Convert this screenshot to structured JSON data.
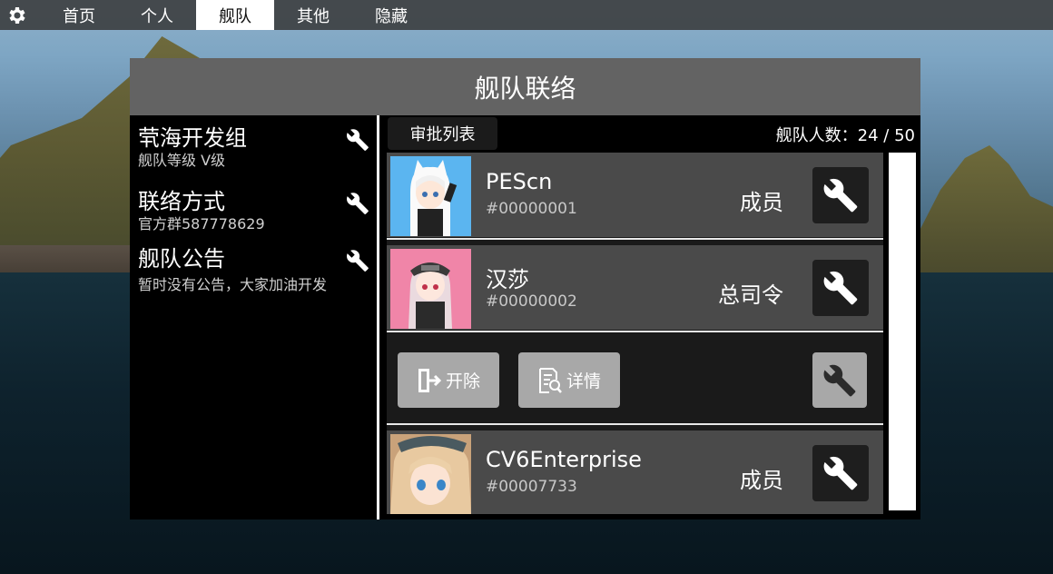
{
  "nav": {
    "tabs": [
      {
        "label": "首页",
        "active": false
      },
      {
        "label": "个人",
        "active": false
      },
      {
        "label": "舰队",
        "active": true
      },
      {
        "label": "其他",
        "active": false
      },
      {
        "label": "隐藏",
        "active": false
      }
    ]
  },
  "panel": {
    "title": "舰队联络"
  },
  "sidebar": {
    "fleet_name": "茕海开发组",
    "fleet_level": "舰队等级 V级",
    "contact_title": "联络方式",
    "contact_value": "官方群587778629",
    "notice_title": "舰队公告",
    "notice_value": "暂时没有公告，大家加油开发"
  },
  "members_header": {
    "approval_button": "审批列表",
    "count_label": "舰队人数：",
    "count_value": "24 / 50"
  },
  "members": [
    {
      "name": "PEScn",
      "id": "#00000001",
      "role": "成员",
      "avatar_color": "#5bb5f0"
    },
    {
      "name": "汉莎",
      "id": "#00000002",
      "role": "总司令",
      "avatar_color": "#f085a8"
    },
    {
      "name": "CV6Enterprise",
      "id": "#00007733",
      "role": "成员",
      "avatar_color": "#c9a27a"
    }
  ],
  "actions": {
    "kick_label": "开除",
    "detail_label": "详情"
  },
  "colors": {
    "panel_header": "#636363",
    "row_bg": "#4a4a4a",
    "action_btn": "#a8a8a8"
  }
}
